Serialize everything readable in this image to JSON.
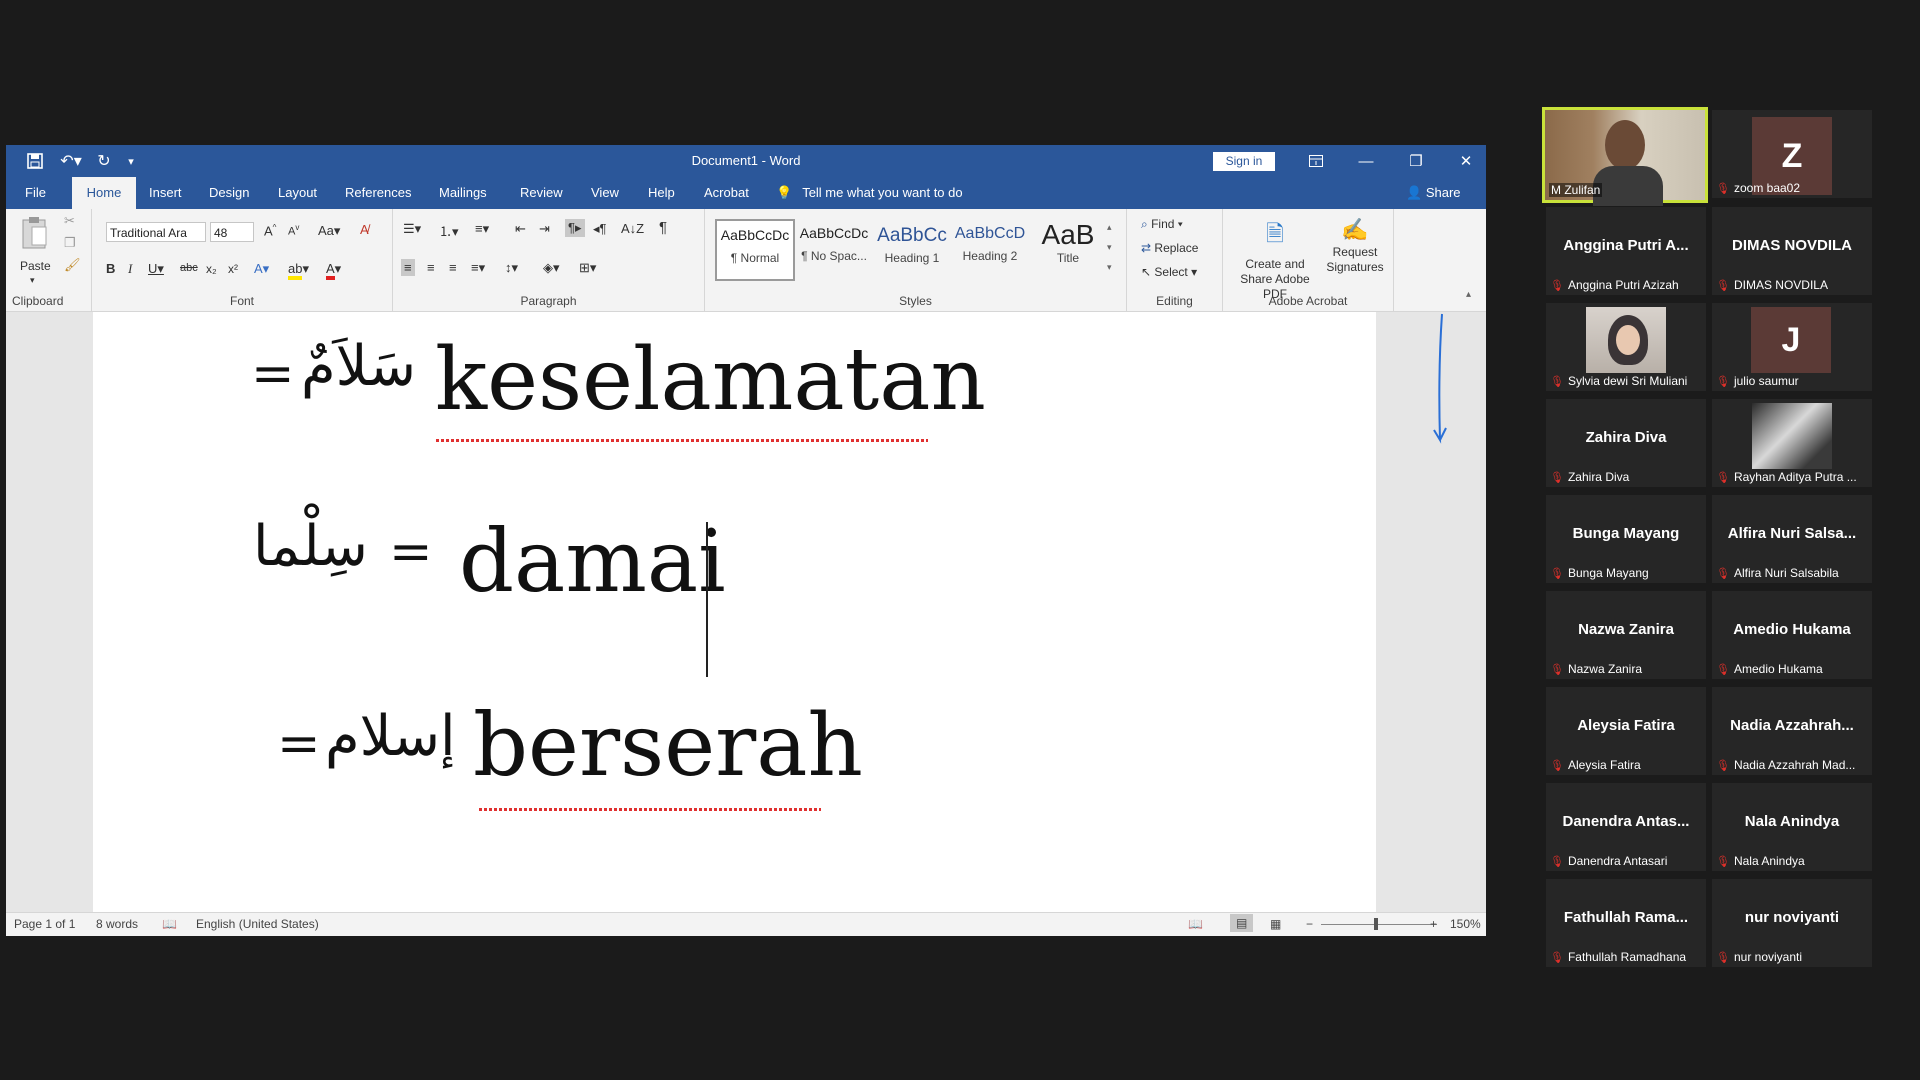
{
  "window": {
    "title": "Document1  -  Word",
    "sign_in": "Sign in"
  },
  "tabs": [
    "File",
    "Home",
    "Insert",
    "Design",
    "Layout",
    "References",
    "Mailings",
    "Review",
    "View",
    "Help",
    "Acrobat"
  ],
  "tell_me": "Tell me what you want to do",
  "share": "Share",
  "ribbon": {
    "clipboard": {
      "paste": "Paste",
      "label": "Clipboard"
    },
    "font": {
      "name": "Traditional Ara",
      "size": "48",
      "label": "Font"
    },
    "paragraph": {
      "label": "Paragraph"
    },
    "styles": {
      "label": "Styles",
      "items": [
        {
          "preview": "AaBbCcDc",
          "name": "¶ Normal"
        },
        {
          "preview": "AaBbCcDc",
          "name": "¶ No Spac..."
        },
        {
          "preview": "AaBbCc",
          "name": "Heading 1"
        },
        {
          "preview": "AaBbCcD",
          "name": "Heading 2"
        },
        {
          "preview": "AaB",
          "name": "Title"
        }
      ]
    },
    "editing": {
      "find": "Find",
      "replace": "Replace",
      "select": "Select",
      "label": "Editing"
    },
    "acrobat": {
      "create": "Create and Share Adobe PDF",
      "request": "Request Signatures",
      "label": "Adobe Acrobat"
    }
  },
  "document": {
    "line1": {
      "arabic": "سَلاَمٌ",
      "latin": "keselamatan"
    },
    "line2": {
      "arabic": "سِلْما",
      "latin": "damai"
    },
    "line3": {
      "arabic": "إسلام",
      "latin": "berserah"
    }
  },
  "status": {
    "page": "Page 1 of 1",
    "words": "8 words",
    "language": "English (United States)",
    "zoom": "150%"
  },
  "participants": [
    {
      "display": "",
      "name": "M Zulifan",
      "type": "video"
    },
    {
      "display": "Z",
      "name": "zoom baa02",
      "type": "avatar"
    },
    {
      "display": "Anggina Putri A...",
      "name": "Anggina Putri Azizah",
      "type": "name"
    },
    {
      "display": "DIMAS NOVDILA",
      "name": "DIMAS NOVDILA",
      "type": "name"
    },
    {
      "display": "",
      "name": "Sylvia dewi Sri Muliani",
      "type": "photo"
    },
    {
      "display": "J",
      "name": "julio saumur",
      "type": "avatar"
    },
    {
      "display": "Zahira Diva",
      "name": "Zahira Diva",
      "type": "name"
    },
    {
      "display": "",
      "name": "Rayhan Aditya Putra ...",
      "type": "photo"
    },
    {
      "display": "Bunga Mayang",
      "name": "Bunga Mayang",
      "type": "name"
    },
    {
      "display": "Alfira Nuri Salsa...",
      "name": "Alfira Nuri Salsabila",
      "type": "name"
    },
    {
      "display": "Nazwa Zanira",
      "name": "Nazwa Zanira",
      "type": "name"
    },
    {
      "display": "Amedio Hukama",
      "name": "Amedio Hukama",
      "type": "name"
    },
    {
      "display": "Aleysia Fatira",
      "name": "Aleysia Fatira",
      "type": "name"
    },
    {
      "display": "Nadia  Azzahrah...",
      "name": "Nadia Azzahrah Mad...",
      "type": "name"
    },
    {
      "display": "Danendra  Antas...",
      "name": "Danendra Antasari",
      "type": "name"
    },
    {
      "display": "Nala Anindya",
      "name": "Nala Anindya",
      "type": "name"
    },
    {
      "display": "Fathullah  Rama...",
      "name": "Fathullah Ramadhana",
      "type": "name"
    },
    {
      "display": "nur noviyanti",
      "name": "nur noviyanti",
      "type": "name"
    }
  ],
  "colors": {
    "word_blue": "#2b579a",
    "tile_bg": "#262626",
    "active_speaker": "#c9e23a",
    "muted": "#e0302a"
  }
}
